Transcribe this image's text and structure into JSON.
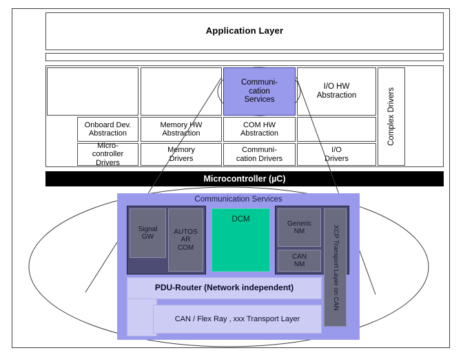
{
  "diagram": {
    "title": "AUTOSAR layered architecture with Communication Services detail",
    "colors": {
      "comm_services_purple": "#9a9aec",
      "detail_panel_purple": "#9a9aec",
      "dcm_green": "#00c896",
      "module_gray": "#6b6b80",
      "module_group_dark": "#4c4c74",
      "lavender": "#ccccf5",
      "microcontroller_black": "#000000",
      "outline": "#4a4a4a"
    }
  },
  "architecture": {
    "application_layer": "Application Layer",
    "rte_band": "",
    "service_layer": [
      {
        "label": "",
        "name": "system-services"
      },
      {
        "label": "",
        "name": "memory-services"
      },
      {
        "label": "Communi-\ncation\nServices",
        "name": "communication-services"
      },
      {
        "label": "I/O HW\nAbstraction",
        "name": "io-hw-abstraction"
      },
      {
        "label": "Complex Drivers",
        "name": "complex-drivers"
      }
    ],
    "abstraction_layer": [
      {
        "label": "Onboard Dev.\nAbstraction",
        "name": "onboard-device-abstraction"
      },
      {
        "label": "Memory HW\nAbstraction",
        "name": "memory-hw-abstraction"
      },
      {
        "label": "COM HW\nAbstraction",
        "name": "com-hw-abstraction"
      },
      {
        "label": "",
        "name": "io-hw-abstraction-spacer"
      }
    ],
    "driver_layer": [
      {
        "label": "Micro-\ncontroller\nDrivers",
        "name": "microcontroller-drivers"
      },
      {
        "label": "Memory\nDrivers",
        "name": "memory-drivers"
      },
      {
        "label": "Communi-\ncation Drivers",
        "name": "communication-drivers"
      },
      {
        "label": "I/O\nDrivers",
        "name": "io-drivers"
      }
    ],
    "microcontroller": "Microcontroller (µC)"
  },
  "detail": {
    "title": "Communication Services",
    "modules": [
      {
        "label": "Signal\nGW",
        "name": "signal-gw"
      },
      {
        "label": "AUTOS\nAR\nCOM",
        "name": "autosar-com"
      },
      {
        "label": "DCM",
        "name": "dcm"
      },
      {
        "label": "Generic\nNM",
        "name": "generic-nm"
      },
      {
        "label": "CAN\nNM",
        "name": "can-nm"
      },
      {
        "label": "XCP Transport Layer on CAN",
        "name": "xcp-transport-layer-on-can"
      },
      {
        "label": "PDU-Router (Network independent)",
        "name": "pdu-router"
      },
      {
        "label": "CAN / Flex Ray , xxx  Transport Layer",
        "name": "can-flexray-transport-layer"
      }
    ]
  }
}
